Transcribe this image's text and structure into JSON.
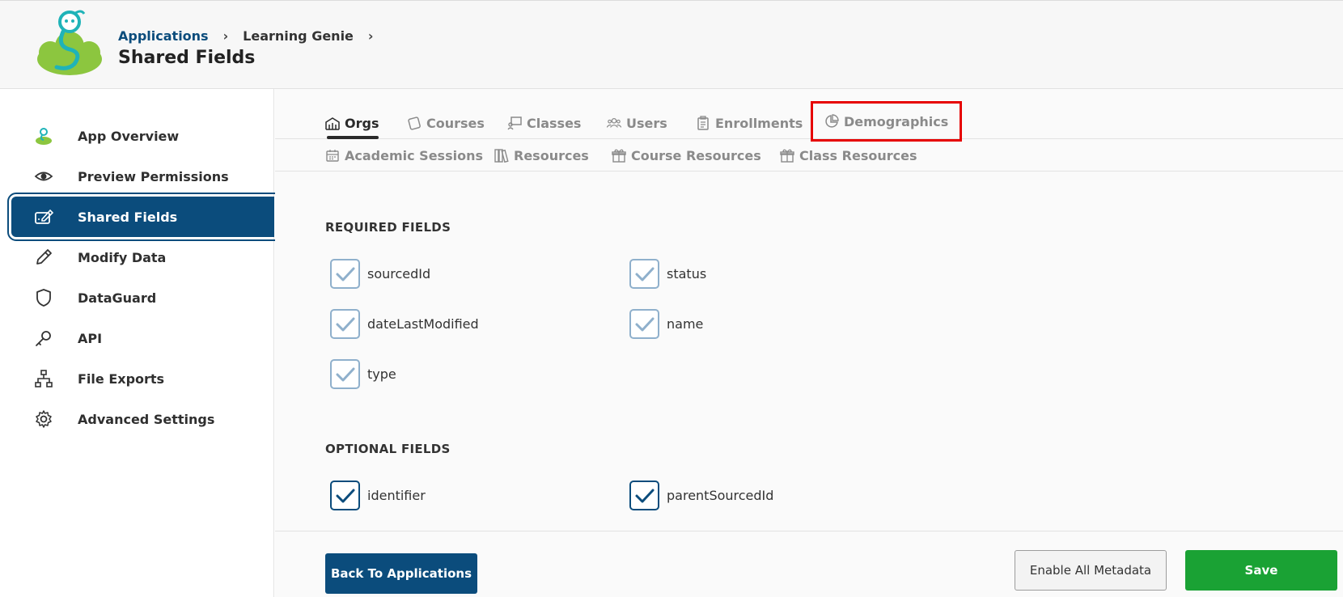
{
  "header": {
    "breadcrumb": [
      "Applications",
      "Learning Genie"
    ],
    "title": "Shared Fields"
  },
  "sidebar": {
    "items": [
      {
        "label": "App Overview",
        "icon": "app-overview-icon"
      },
      {
        "label": "Preview Permissions",
        "icon": "eye-icon"
      },
      {
        "label": "Shared Fields",
        "icon": "pen-square-icon"
      },
      {
        "label": "Modify Data",
        "icon": "pencil-icon"
      },
      {
        "label": "DataGuard",
        "icon": "shield-icon"
      },
      {
        "label": "API",
        "icon": "key-icon"
      },
      {
        "label": "File Exports",
        "icon": "network-icon"
      },
      {
        "label": "Advanced Settings",
        "icon": "gear-icon"
      }
    ],
    "active": "Shared Fields"
  },
  "tabs": {
    "row1": [
      "Orgs",
      "Courses",
      "Classes",
      "Users",
      "Enrollments",
      "Demographics"
    ],
    "row2": [
      "Academic Sessions",
      "Resources",
      "Course Resources",
      "Class Resources"
    ],
    "active": "Orgs",
    "highlighted": "Demographics"
  },
  "required": {
    "title": "REQUIRED FIELDS",
    "fields": [
      "sourcedId",
      "status",
      "dateLastModified",
      "name",
      "type"
    ]
  },
  "optional": {
    "title": "OPTIONAL FIELDS",
    "fields": [
      "identifier",
      "parentSourcedId"
    ]
  },
  "footer": {
    "back": "Back To Applications",
    "enable_metadata": "Enable All Metadata",
    "save": "Save"
  },
  "colors": {
    "primary": "#0b4c7c",
    "save": "#1aa234",
    "highlight": "#e60000",
    "checkbox_light": "#8fb0cc"
  }
}
